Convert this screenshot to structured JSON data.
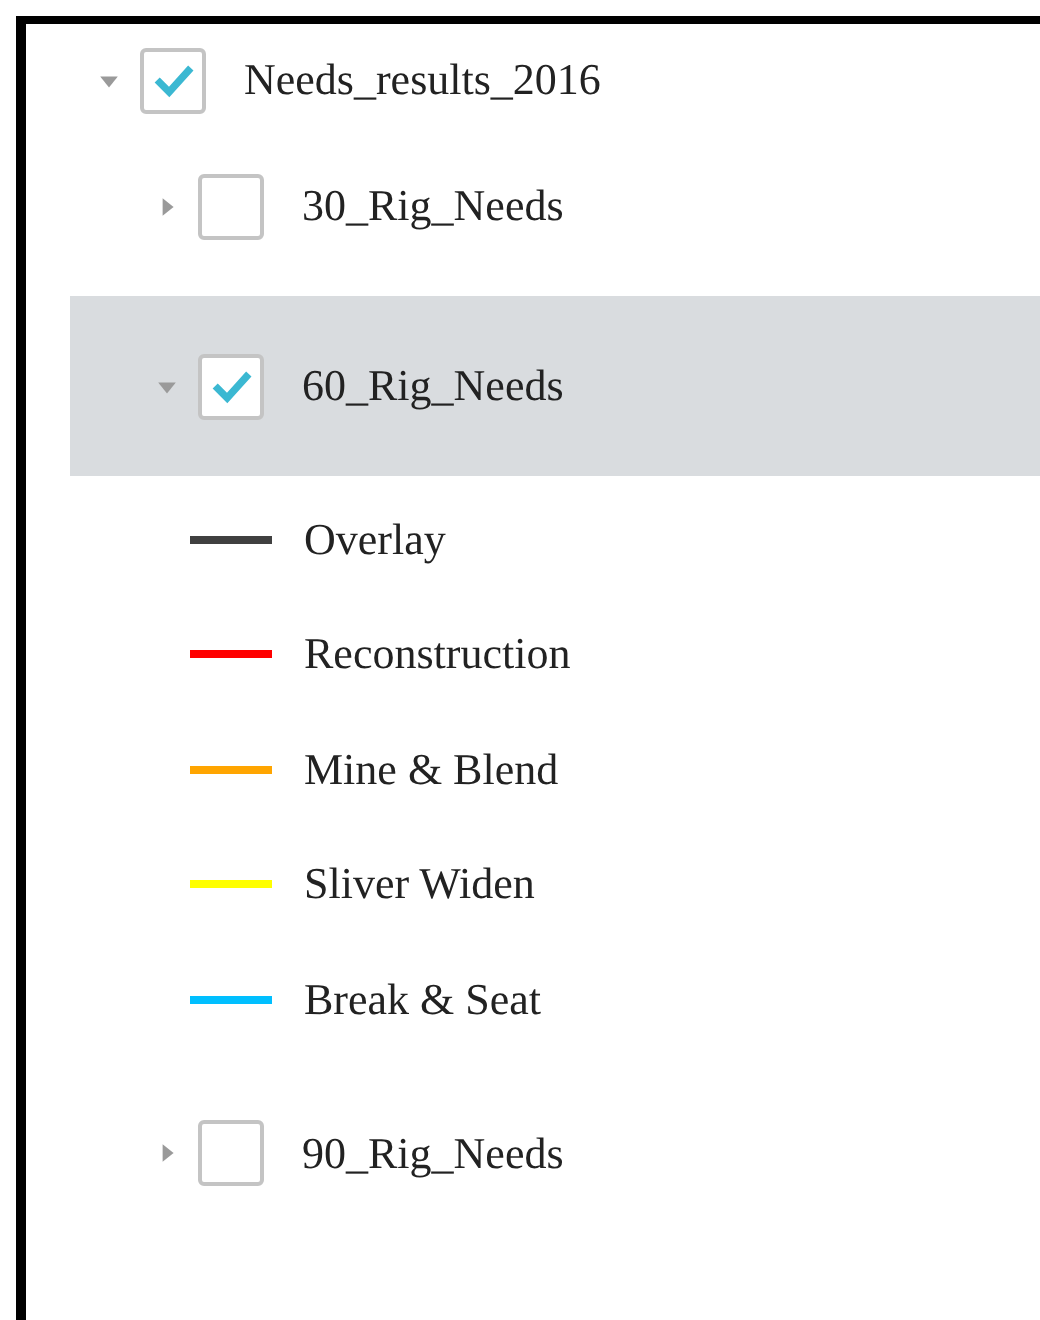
{
  "tree": {
    "label": "Needs_results_2016",
    "checked": true,
    "expanded": true,
    "children": [
      {
        "label": "30_Rig_Needs",
        "checked": false,
        "expanded": false,
        "selected": false
      },
      {
        "label": "60_Rig_Needs",
        "checked": true,
        "expanded": true,
        "selected": true,
        "legend": [
          {
            "label": "Overlay",
            "color": "#404040"
          },
          {
            "label": "Reconstruction",
            "color": "#ff0000"
          },
          {
            "label": "Mine & Blend",
            "color": "#ffa500"
          },
          {
            "label": "Sliver Widen",
            "color": "#ffff00"
          },
          {
            "label": "Break & Seat",
            "color": "#00bfff"
          }
        ]
      },
      {
        "label": "90_Rig_Needs",
        "checked": false,
        "expanded": false,
        "selected": false
      }
    ]
  }
}
